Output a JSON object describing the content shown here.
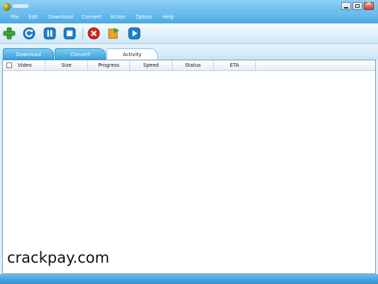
{
  "menu": {
    "items": [
      "File",
      "Edit",
      "Download",
      "Convert",
      "Action",
      "Option",
      "Help"
    ]
  },
  "toolbar": {
    "buttons": [
      {
        "name": "add-icon",
        "color": "#3aa83a"
      },
      {
        "name": "refresh-icon",
        "color": "#1e7fcf"
      },
      {
        "name": "pause-icon",
        "color": "#1e7fcf"
      },
      {
        "name": "stop-icon",
        "color": "#1e7fcf"
      },
      {
        "name": "delete-icon",
        "color": "#d9261c"
      },
      {
        "name": "convert-icon",
        "color": "#f0a520"
      },
      {
        "name": "play-icon",
        "color": "#1e7fcf"
      }
    ]
  },
  "tabs": {
    "download": "Download",
    "convert": "Convert",
    "activity": "Activity",
    "active": "activity"
  },
  "table": {
    "columns": [
      "Video",
      "Size",
      "Progress",
      "Speed",
      "Status",
      "ETA"
    ],
    "rows": []
  },
  "watermark": "crackpay.com",
  "colors": {
    "accent": "#3ca2dd",
    "titlebar": "#64b8ea",
    "tab_inactive": "#3ca2dd"
  }
}
